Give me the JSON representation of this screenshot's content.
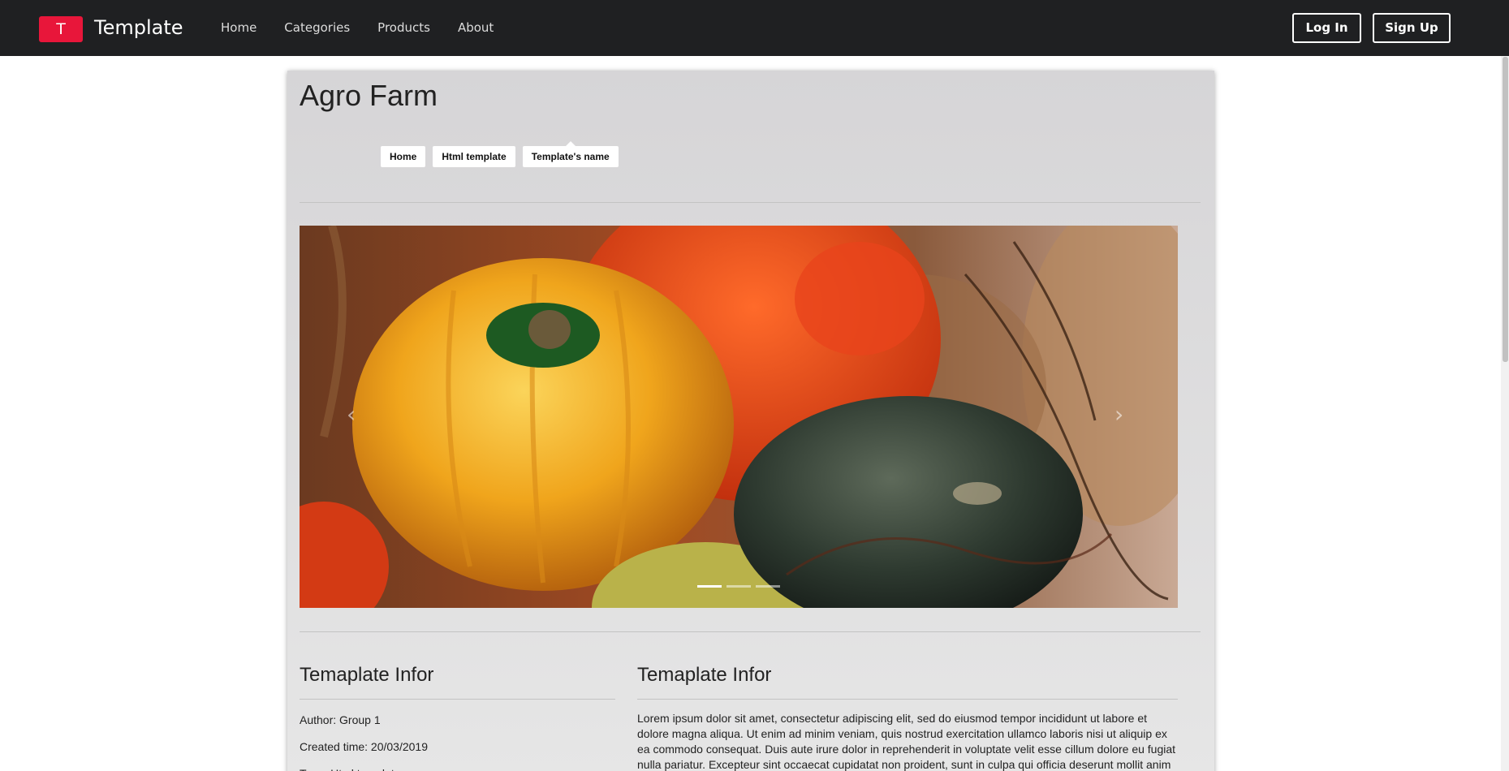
{
  "navbar": {
    "logo_letter": "T",
    "brand": "Template",
    "links": [
      "Home",
      "Categories",
      "Products",
      "About"
    ],
    "login_label": "Log In",
    "signup_label": "Sign Up",
    "logo_color": "#e8163a"
  },
  "page": {
    "title": "Agro Farm",
    "breadcrumb": [
      "Home",
      "Html template",
      "Template's name"
    ]
  },
  "carousel": {
    "prev_icon": "chevron-left-icon",
    "next_icon": "chevron-right-icon",
    "slide_count": 3,
    "active_slide": 1
  },
  "info_left": {
    "heading": "Temaplate Infor",
    "author": "Author: Group 1",
    "created": "Created time: 20/03/2019",
    "type": "Type: Html template"
  },
  "info_right": {
    "heading": "Temaplate Infor",
    "body": "Lorem ipsum dolor sit amet, consectetur adipiscing elit, sed do eiusmod tempor incididunt ut labore et dolore magna aliqua. Ut enim ad minim veniam, quis nostrud exercitation ullamco laboris nisi ut aliquip ex ea commodo consequat. Duis aute irure dolor in reprehenderit in voluptate velit esse cillum dolore eu fugiat nulla pariatur. Excepteur sint occaecat cupidatat non proident, sunt in culpa qui officia deserunt mollit anim id est laborum."
  }
}
